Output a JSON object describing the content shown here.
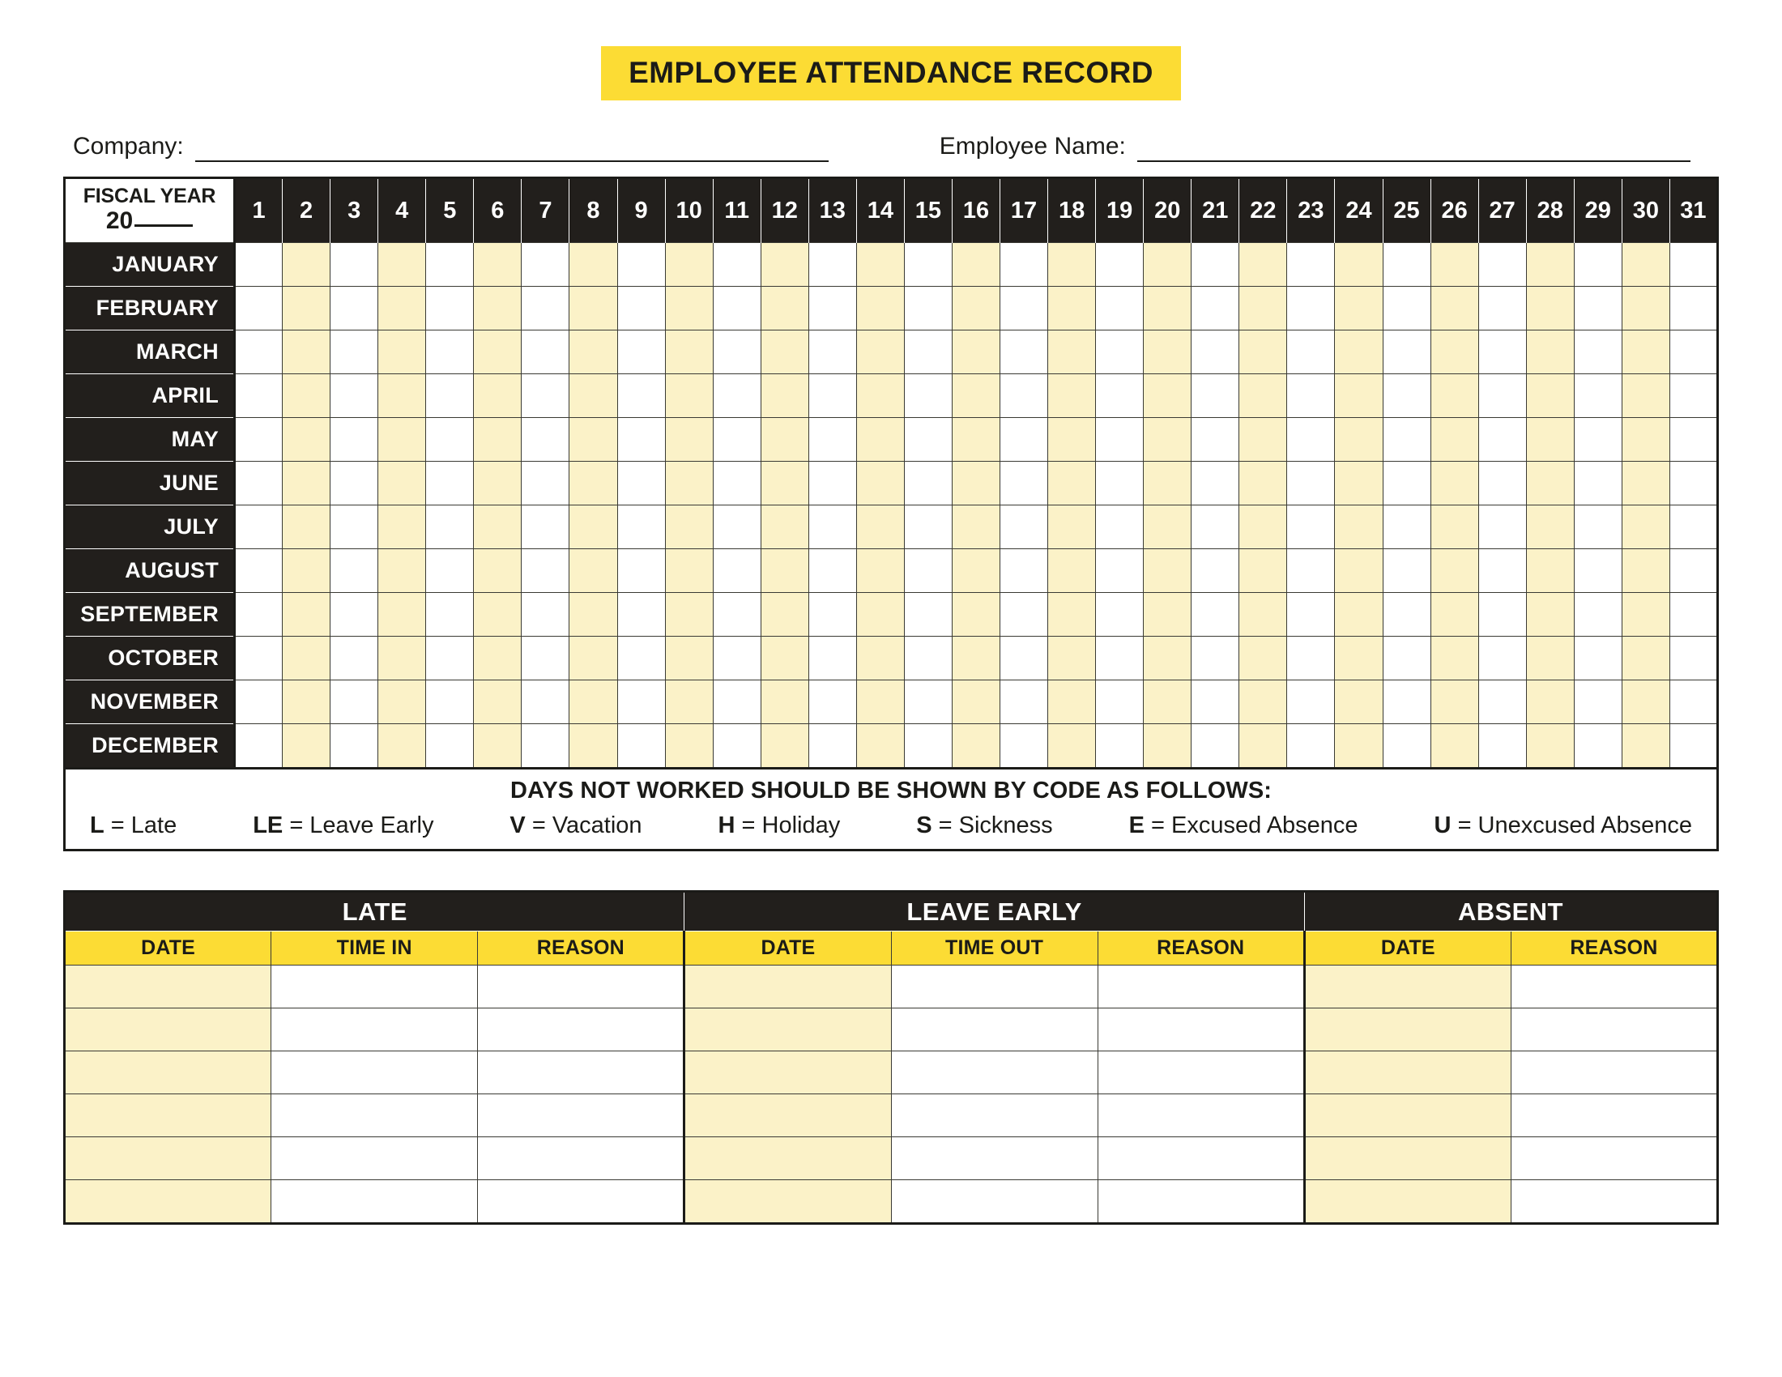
{
  "title": "EMPLOYEE ATTENDANCE RECORD",
  "colors": {
    "banner_yellow": "#FCDC34",
    "cell_yellow": "#FBF2C8",
    "header_black": "#221f1c",
    "text_black": "#1b1b18"
  },
  "meta": {
    "company_label": "Company:",
    "company_value": "",
    "employee_label": "Employee Name:",
    "employee_value": ""
  },
  "calendar": {
    "fiscal_year_label": "FISCAL YEAR",
    "fiscal_year_prefix": "20",
    "fiscal_year_value": "",
    "days": [
      1,
      2,
      3,
      4,
      5,
      6,
      7,
      8,
      9,
      10,
      11,
      12,
      13,
      14,
      15,
      16,
      17,
      18,
      19,
      20,
      21,
      22,
      23,
      24,
      25,
      26,
      27,
      28,
      29,
      30,
      31
    ],
    "months": [
      "JANUARY",
      "FEBRUARY",
      "MARCH",
      "APRIL",
      "MAY",
      "JUNE",
      "JULY",
      "AUGUST",
      "SEPTEMBER",
      "OCTOBER",
      "NOVEMBER",
      "DECEMBER"
    ]
  },
  "legend": {
    "heading": "DAYS NOT WORKED SHOULD BE SHOWN BY CODE AS FOLLOWS:",
    "codes": [
      {
        "key": "L",
        "eq": "= Late"
      },
      {
        "key": "LE",
        "eq": "= Leave Early"
      },
      {
        "key": "V",
        "eq": "= Vacation"
      },
      {
        "key": "H",
        "eq": "= Holiday"
      },
      {
        "key": "S",
        "eq": "= Sickness"
      },
      {
        "key": "E",
        "eq": "= Excused Absence"
      },
      {
        "key": "U",
        "eq": "= Unexcused Absence"
      }
    ]
  },
  "log": {
    "groups": [
      {
        "title": "LATE",
        "columns": [
          "DATE",
          "TIME IN",
          "REASON"
        ]
      },
      {
        "title": "LEAVE EARLY",
        "columns": [
          "DATE",
          "TIME OUT",
          "REASON"
        ]
      },
      {
        "title": "ABSENT",
        "columns": [
          "DATE",
          "REASON"
        ]
      }
    ],
    "row_count": 6,
    "rows": [
      {
        "late": {
          "date": "",
          "time": "",
          "reason": ""
        },
        "leave_early": {
          "date": "",
          "time": "",
          "reason": ""
        },
        "absent": {
          "date": "",
          "reason": ""
        }
      },
      {
        "late": {
          "date": "",
          "time": "",
          "reason": ""
        },
        "leave_early": {
          "date": "",
          "time": "",
          "reason": ""
        },
        "absent": {
          "date": "",
          "reason": ""
        }
      },
      {
        "late": {
          "date": "",
          "time": "",
          "reason": ""
        },
        "leave_early": {
          "date": "",
          "time": "",
          "reason": ""
        },
        "absent": {
          "date": "",
          "reason": ""
        }
      },
      {
        "late": {
          "date": "",
          "time": "",
          "reason": ""
        },
        "leave_early": {
          "date": "",
          "time": "",
          "reason": ""
        },
        "absent": {
          "date": "",
          "reason": ""
        }
      },
      {
        "late": {
          "date": "",
          "time": "",
          "reason": ""
        },
        "leave_early": {
          "date": "",
          "time": "",
          "reason": ""
        },
        "absent": {
          "date": "",
          "reason": ""
        }
      },
      {
        "late": {
          "date": "",
          "time": "",
          "reason": ""
        },
        "leave_early": {
          "date": "",
          "time": "",
          "reason": ""
        },
        "absent": {
          "date": "",
          "reason": ""
        }
      }
    ]
  }
}
